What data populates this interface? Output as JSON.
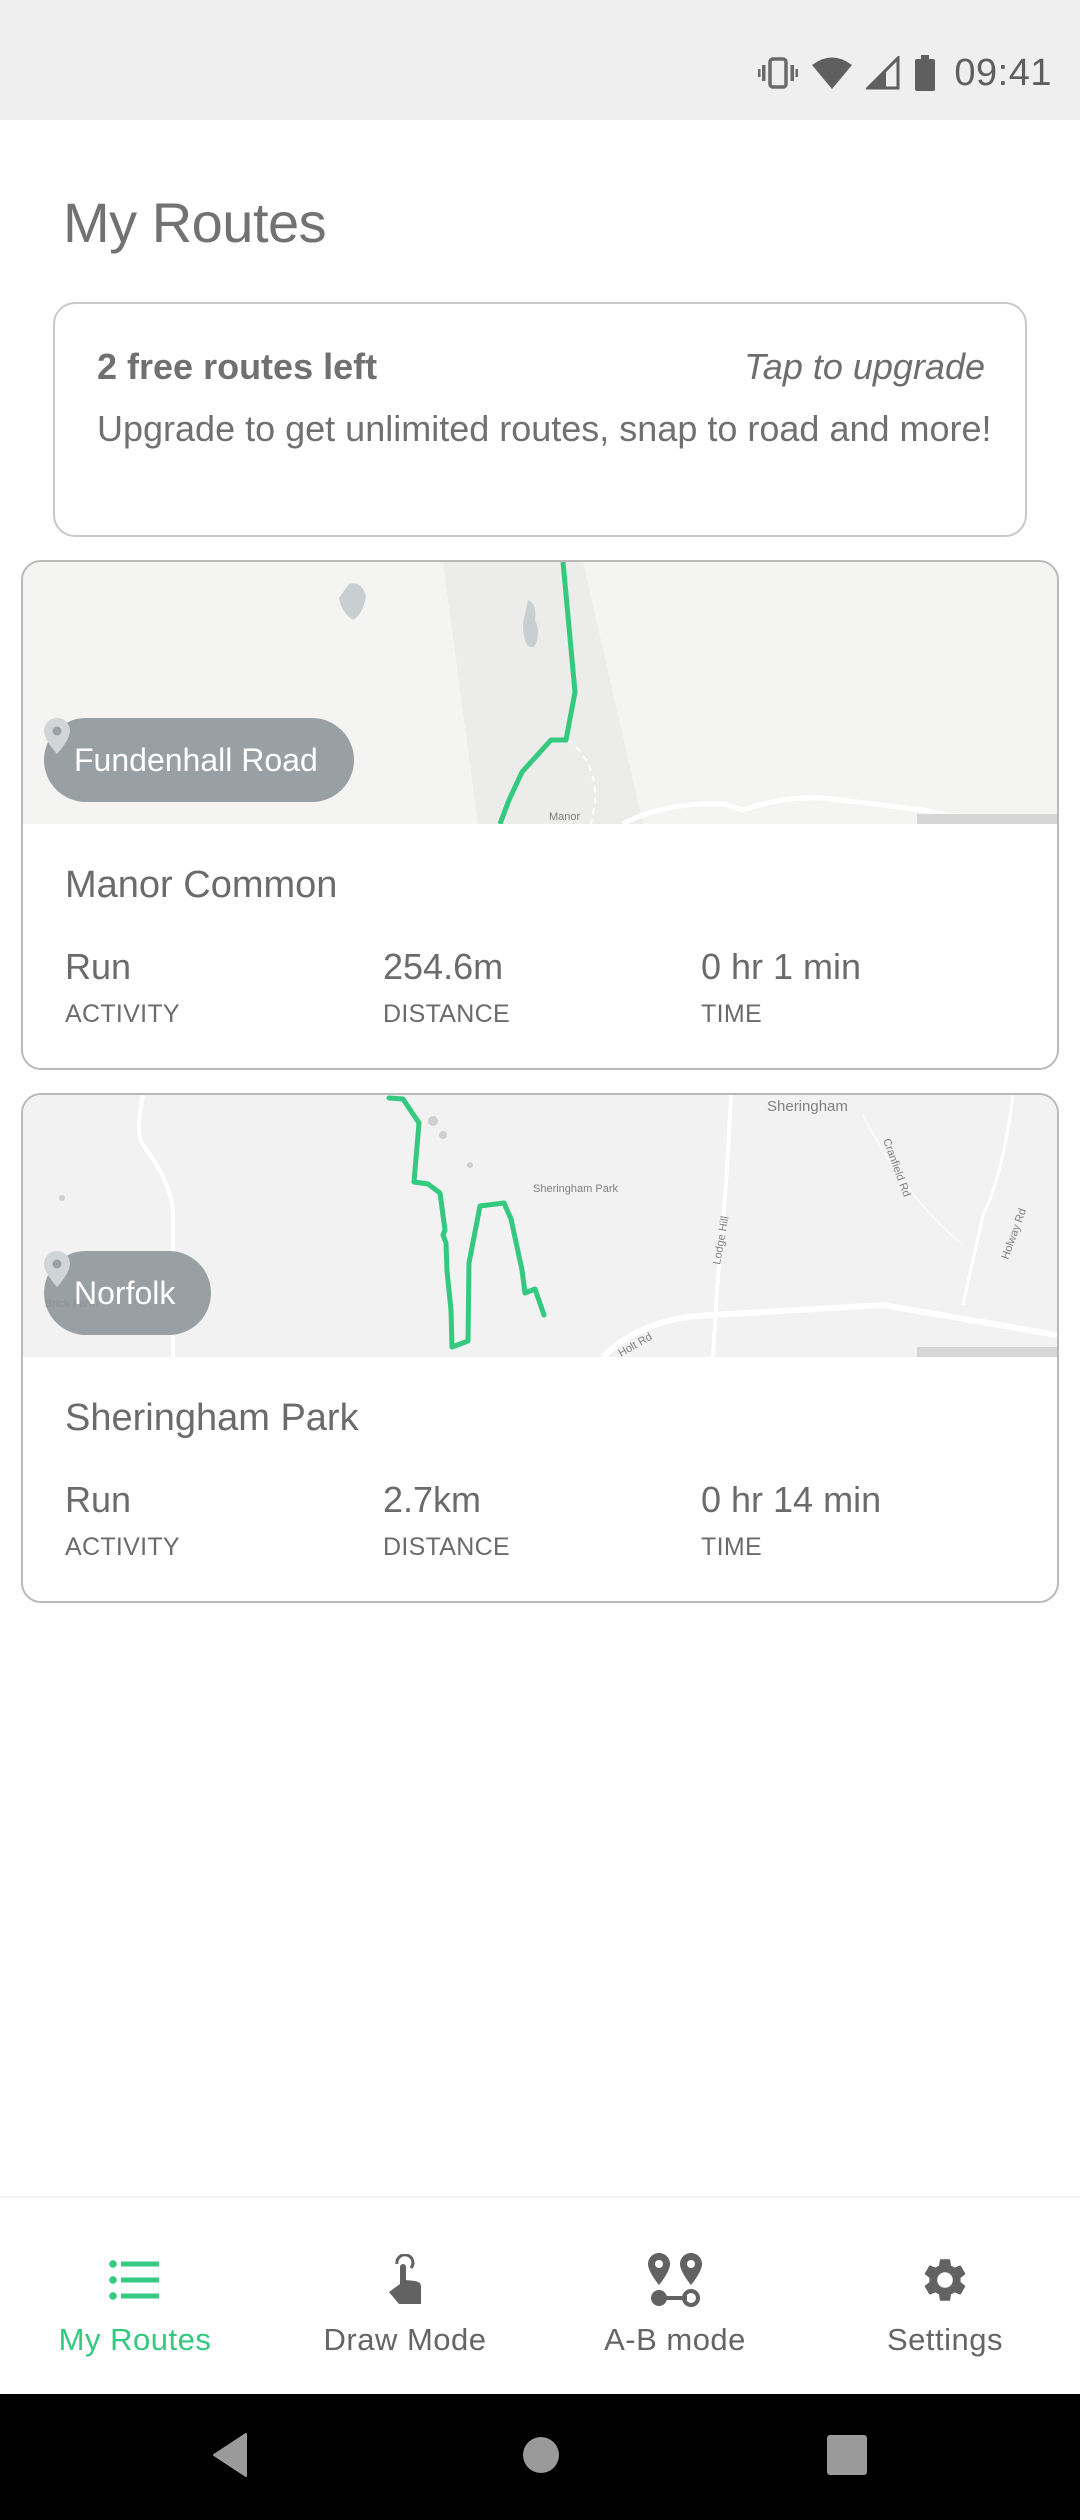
{
  "status_bar": {
    "time": "09:41",
    "icons": [
      "vibrate-icon",
      "wifi-icon",
      "cell-signal-icon",
      "battery-icon"
    ]
  },
  "header": {
    "title": "My Routes"
  },
  "upgrade_banner": {
    "title": "2 free routes left",
    "action": "Tap to upgrade",
    "description": "Upgrade to get unlimited routes, snap to road and more!"
  },
  "routes": [
    {
      "location": "Fundenhall Road",
      "name": "Manor Common",
      "map_labels": [
        "Manor"
      ],
      "stats": [
        {
          "value": "Run",
          "label": "ACTIVITY"
        },
        {
          "value": "254.6m",
          "label": "DISTANCE"
        },
        {
          "value": "0 hr 1 min",
          "label": "TIME"
        }
      ]
    },
    {
      "location": "Norfolk",
      "name": "Sheringham Park",
      "map_labels": [
        "Sheringham",
        "Sheringham Park",
        "Cranfield Rd",
        "Lodge Hill",
        "Holway Rd",
        "Holt Rd",
        "Brick Farm"
      ],
      "stats": [
        {
          "value": "Run",
          "label": "ACTIVITY"
        },
        {
          "value": "2.7km",
          "label": "DISTANCE"
        },
        {
          "value": "0 hr 14 min",
          "label": "TIME"
        }
      ]
    }
  ],
  "bottom_nav": {
    "active_index": 0,
    "items": [
      {
        "label": "My Routes",
        "icon": "list-icon"
      },
      {
        "label": "Draw Mode",
        "icon": "touch-icon"
      },
      {
        "label": "A-B mode",
        "icon": "ab-route-icon"
      },
      {
        "label": "Settings",
        "icon": "gear-icon"
      }
    ]
  },
  "colors": {
    "accent": "#33c97f",
    "route_line": "#33c97f",
    "text": "#6f6f6f",
    "pill_bg": "#8c9499"
  }
}
